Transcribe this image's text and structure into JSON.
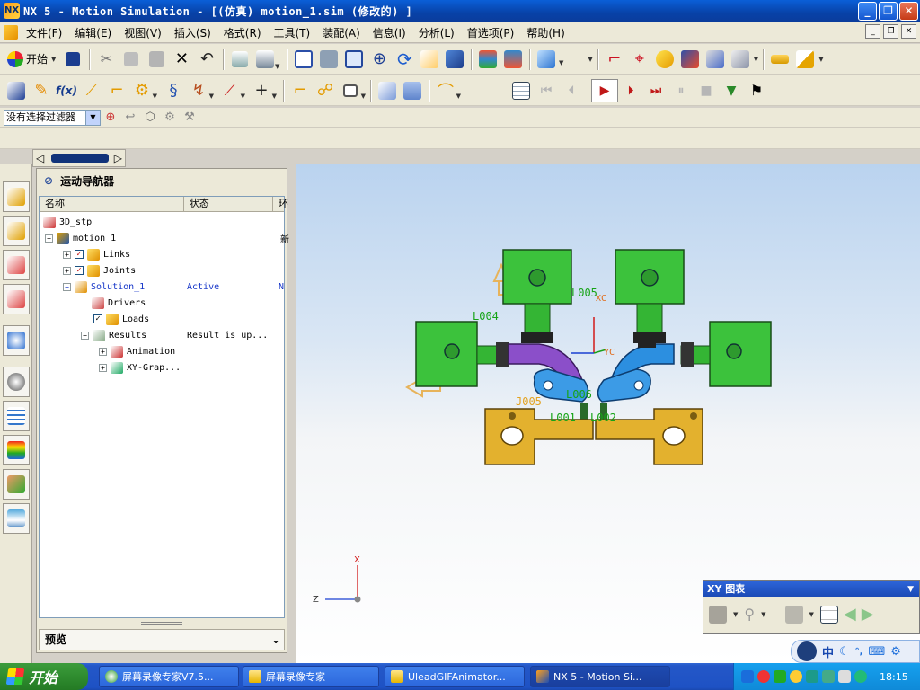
{
  "window": {
    "title": "NX 5 - Motion Simulation - [(仿真) motion_1.sim  (修改的) ]",
    "minimize": "_",
    "maximize": "❐",
    "close": "✕"
  },
  "menu": [
    "文件(F)",
    "编辑(E)",
    "视图(V)",
    "插入(S)",
    "格式(R)",
    "工具(T)",
    "装配(A)",
    "信息(I)",
    "分析(L)",
    "首选项(P)",
    "帮助(H)"
  ],
  "toolbar": {
    "start_label": "开始"
  },
  "filter": {
    "selected": "没有选择过滤器"
  },
  "navigator": {
    "title": "运动导航器",
    "columns": [
      "名称",
      "状态",
      "环"
    ],
    "rows": [
      {
        "label": "3D_stp",
        "status": "",
        "extra": ""
      },
      {
        "label": "motion_1",
        "status": "",
        "extra": "新"
      },
      {
        "label": "Links",
        "status": "",
        "extra": ""
      },
      {
        "label": "Joints",
        "status": "",
        "extra": ""
      },
      {
        "label": "Solution_1",
        "status": "Active",
        "extra": "N"
      },
      {
        "label": "Drivers",
        "status": "",
        "extra": ""
      },
      {
        "label": "Loads",
        "status": "",
        "extra": ""
      },
      {
        "label": "Results",
        "status": "Result is up...",
        "extra": ""
      },
      {
        "label": "Animation",
        "status": "",
        "extra": ""
      },
      {
        "label": "XY-Grap...",
        "status": "",
        "extra": ""
      }
    ],
    "preview": "预览"
  },
  "scene": {
    "labels": [
      "L004",
      "L005",
      "XC",
      "YC",
      "J005",
      "L006",
      "L001",
      "L002"
    ],
    "triad": {
      "x": "X",
      "z": "Z"
    }
  },
  "xy_graph": {
    "title": "XY 图表"
  },
  "language_bar": {
    "text": "中"
  },
  "taskbar": {
    "start": "开始",
    "tasks": [
      "屏幕录像专家V7.5...",
      "屏幕录像专家",
      "UleadGIFAnimator...",
      "NX 5 - Motion Si..."
    ],
    "clock": "18:15"
  }
}
